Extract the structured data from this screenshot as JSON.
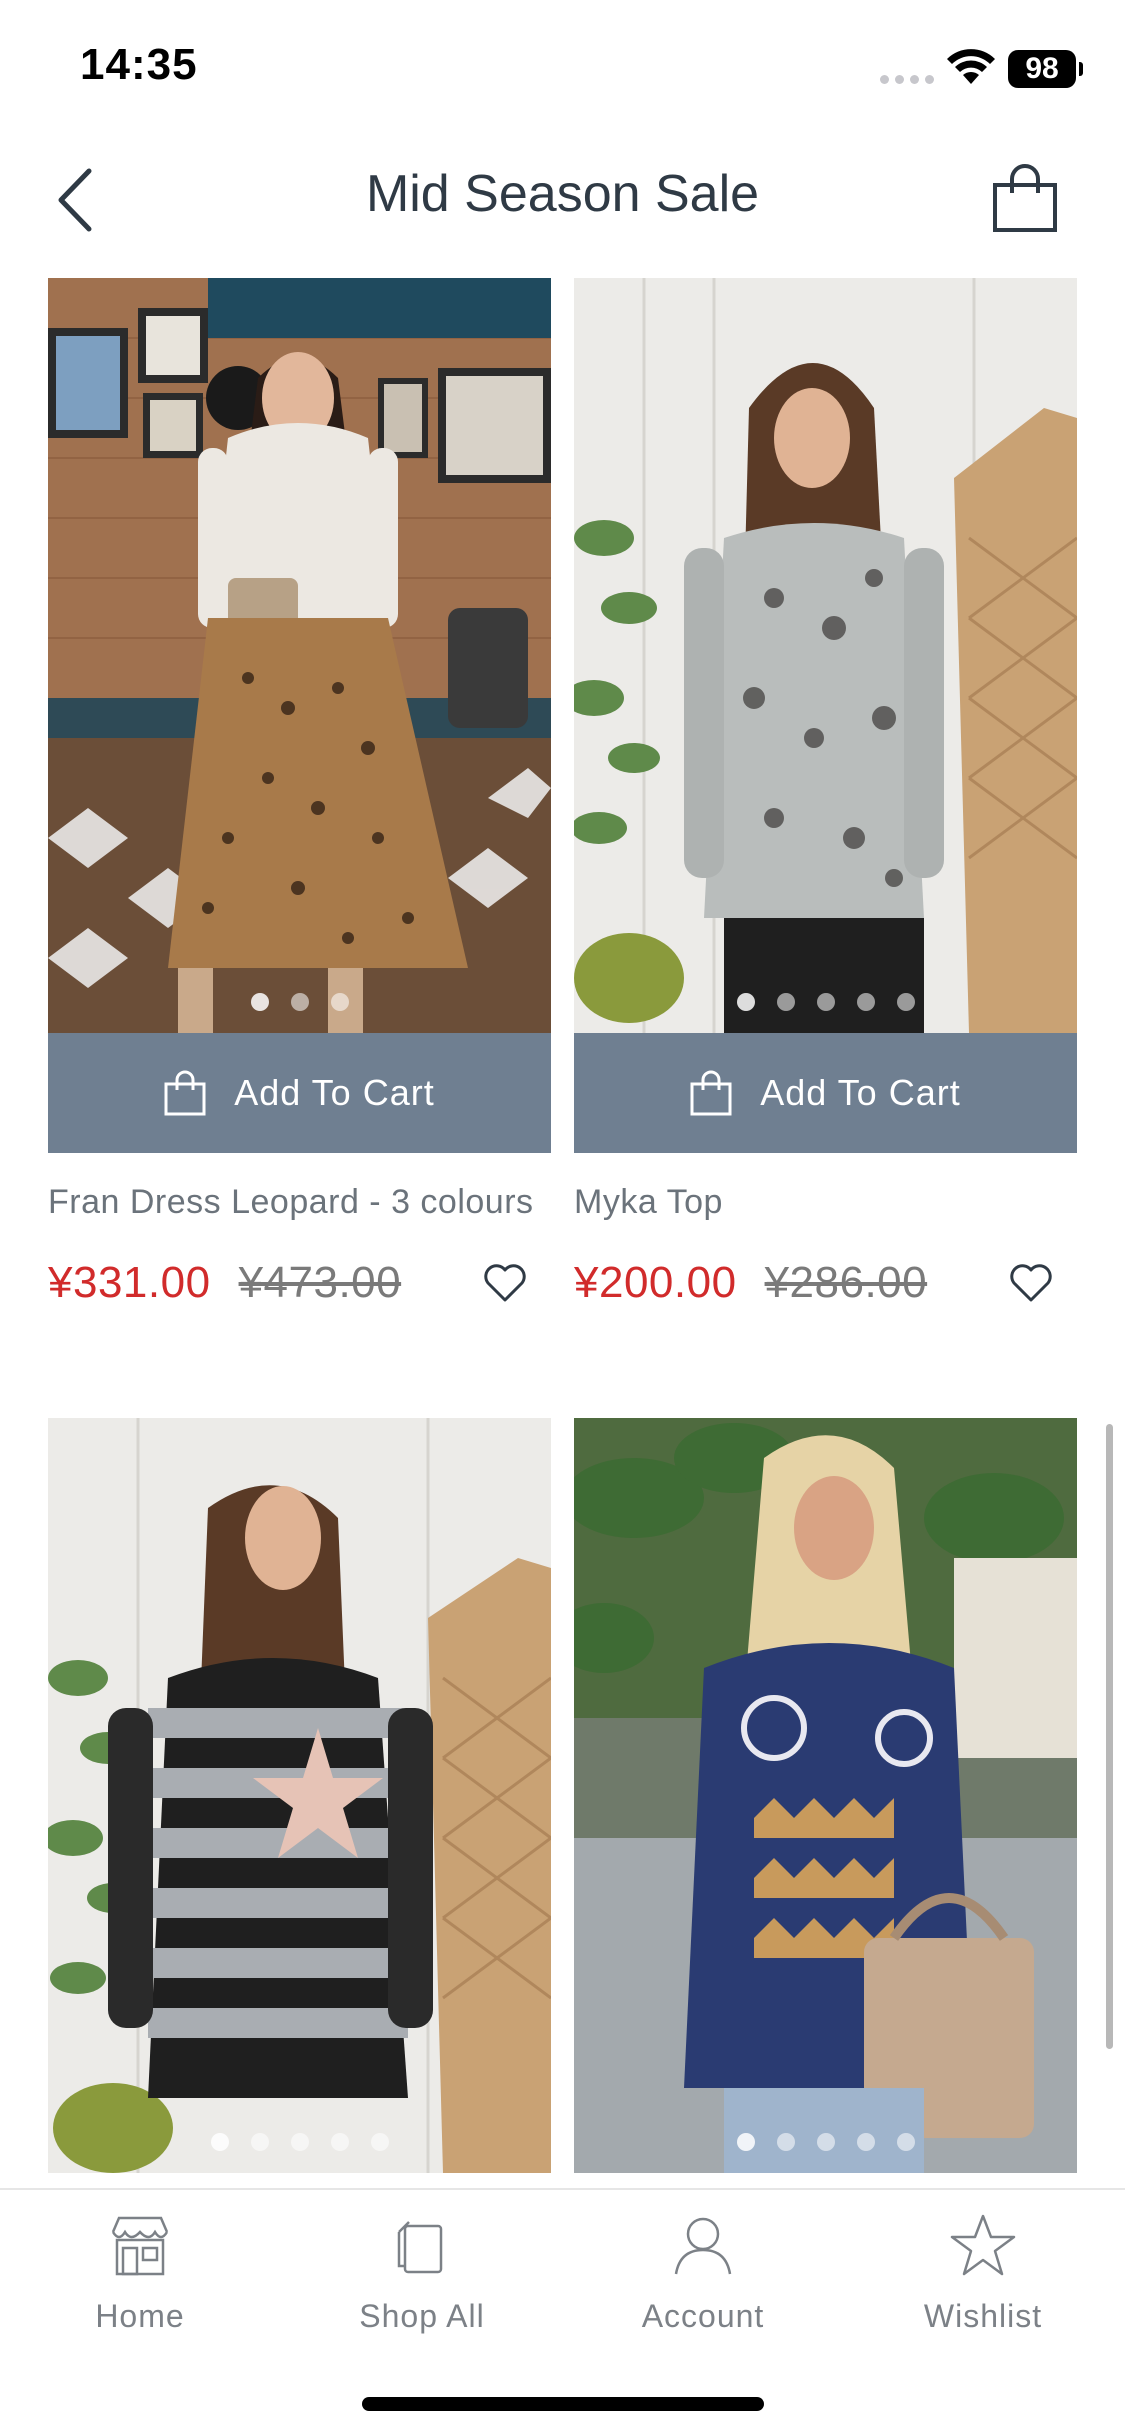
{
  "status_bar": {
    "time": "14:35",
    "battery": "98"
  },
  "header": {
    "title": "Mid Season Sale"
  },
  "products": [
    {
      "name": "Fran Dress Leopard - 3 colours",
      "sale_price": "¥331.00",
      "original_price": "¥473.00",
      "add_to_cart_label": "Add To Cart",
      "image_count": 3,
      "active_image": 1
    },
    {
      "name": "Myka Top",
      "sale_price": "¥200.00",
      "original_price": "¥286.00",
      "add_to_cart_label": "Add To Cart",
      "image_count": 5,
      "active_image": 1
    },
    {
      "name": "",
      "image_count": 5,
      "active_image": 1
    },
    {
      "name": "",
      "image_count": 5,
      "active_image": 1
    }
  ],
  "tabbar": {
    "items": [
      {
        "label": "Home",
        "icon": "storefront-icon"
      },
      {
        "label": "Shop All",
        "icon": "shop-all-icon"
      },
      {
        "label": "Account",
        "icon": "account-icon"
      },
      {
        "label": "Wishlist",
        "icon": "star-icon"
      }
    ]
  },
  "colors": {
    "add_to_cart_bg": "#6f7f91",
    "sale_price": "#d12b2b",
    "title": "#2f3a45",
    "tab_label": "#7c8187"
  }
}
